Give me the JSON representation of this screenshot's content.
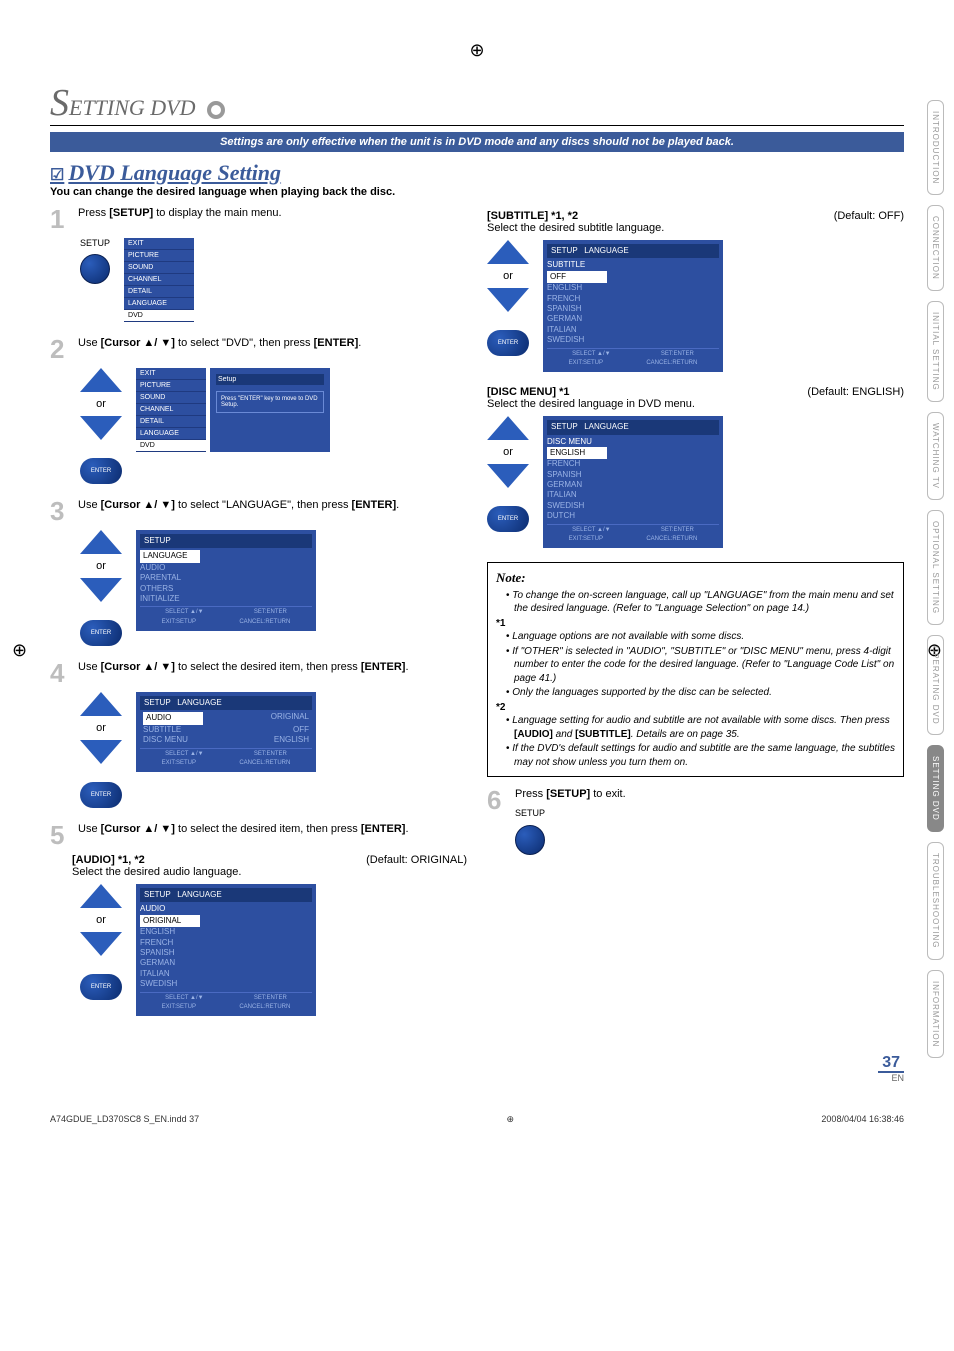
{
  "registration_mark": "⊕",
  "page_title_prefix": "S",
  "page_title_rest": "ETTING   DVD",
  "banner": "Settings are only effective when the unit is in DVD mode and any discs should not be played back.",
  "section_check": "☑",
  "section_title": "DVD Language Setting",
  "section_sub": "You can change the desired language when playing back the disc.",
  "steps": {
    "s1": {
      "num": "1",
      "text_a": "Press ",
      "b1": "[SETUP]",
      "text_b": " to display the main menu."
    },
    "s2": {
      "num": "2",
      "text_a": "Use ",
      "b1": "[Cursor ▲/ ▼]",
      "text_b": " to select \"DVD\", then press ",
      "b2": "[ENTER]",
      "text_c": "."
    },
    "s3": {
      "num": "3",
      "text_a": "Use ",
      "b1": "[Cursor ▲/ ▼]",
      "text_b": " to select \"LANGUAGE\", then press ",
      "b2": "[ENTER]",
      "text_c": "."
    },
    "s4": {
      "num": "4",
      "text_a": "Use ",
      "b1": "[Cursor ▲/ ▼]",
      "text_b": " to select the desired item, then press ",
      "b2": "[ENTER]",
      "text_c": "."
    },
    "s5": {
      "num": "5",
      "text_a": "Use ",
      "b1": "[Cursor ▲/ ▼]",
      "text_b": " to select the desired item, then press ",
      "b2": "[ENTER]",
      "text_c": "."
    },
    "s6": {
      "num": "6",
      "text_a": "Press ",
      "b1": "[SETUP]",
      "text_b": " to exit."
    }
  },
  "remote": {
    "setup": "SETUP",
    "or": "or",
    "enter": "ENTER"
  },
  "osd_main_menu": [
    "EXIT",
    "PICTURE",
    "SOUND",
    "CHANNEL",
    "DETAIL",
    "LANGUAGE",
    "DVD"
  ],
  "osd_setup_hdr": "Setup",
  "osd_setup_msg": "Press \"ENTER\" key to move to DVD Setup.",
  "osd_lang_menu": {
    "hdr": "SETUP",
    "sel": "LANGUAGE",
    "items": [
      "AUDIO",
      "PARENTAL",
      "OTHERS",
      "INITIALIZE"
    ]
  },
  "osd_item_menu": {
    "hdr": "SETUP",
    "crumb": "LANGUAGE",
    "rows": [
      [
        "AUDIO",
        "ORIGINAL"
      ],
      [
        "SUBTITLE",
        "OFF"
      ],
      [
        "DISC MENU",
        "ENGLISH"
      ]
    ]
  },
  "osd_foot": {
    "l1": "SELECT ▲/▼",
    "l2": "EXIT:SETUP",
    "r1": "SET:ENTER",
    "r2": "CANCEL:RETURN"
  },
  "audio": {
    "head": "[AUDIO] *1, *2",
    "def": "(Default: ORIGINAL)",
    "line": "Select the desired audio language.",
    "osd_hdr": "SETUP",
    "crumb": "LANGUAGE",
    "sub": "AUDIO",
    "sel": "ORIGINAL",
    "items": [
      "ENGLISH",
      "FRENCH",
      "SPANISH",
      "GERMAN",
      "ITALIAN",
      "SWEDISH"
    ]
  },
  "subtitle": {
    "head": "[SUBTITLE] *1, *2",
    "def": "(Default: OFF)",
    "line": "Select the desired subtitle language.",
    "sub": "SUBTITLE",
    "sel": "OFF",
    "items": [
      "ENGLISH",
      "FRENCH",
      "SPANISH",
      "GERMAN",
      "ITALIAN",
      "SWEDISH"
    ]
  },
  "discmenu": {
    "head": "[DISC MENU] *1",
    "def": "(Default: ENGLISH)",
    "line": "Select the desired language in DVD menu.",
    "sub": "DISC MENU",
    "sel": "ENGLISH",
    "items": [
      "FRENCH",
      "SPANISH",
      "GERMAN",
      "ITALIAN",
      "SWEDISH",
      "DUTCH"
    ]
  },
  "note": {
    "title": "Note:",
    "b1": "To change the on-screen language, call up \"LANGUAGE\" from the main menu and set the desired language. (Refer to \"Language Selection\" on page 14.)",
    "a1": "*1",
    "b2": "Language options are not available with some discs.",
    "b3": "If \"OTHER\" is selected in \"AUDIO\", \"SUBTITLE\" or \"DISC MENU\" menu, press 4-digit number to enter the code for the desired language. (Refer to \"Language Code List\" on page 41.)",
    "b4": "Only the languages supported by the disc can be selected.",
    "a2": "*2",
    "b5_a": "Language setting for audio and subtitle are not available with some discs. Then press ",
    "b5_b1": "[AUDIO]",
    "b5_mid": " and ",
    "b5_b2": "[SUBTITLE]",
    "b5_c": ". Details are on page 35.",
    "b6": "If the DVD's default settings for audio and subtitle are the same language, the subtitles may not show unless you turn them on."
  },
  "tabs": [
    "INTRODUCTION",
    "CONNECTION",
    "INITIAL SETTING",
    "WATCHING TV",
    "OPTIONAL SETTING",
    "OPERATING DVD",
    "SETTING DVD",
    "TROUBLESHOOTING",
    "INFORMATION"
  ],
  "tabs_active_index": 6,
  "page_number": "37",
  "page_lang": "EN",
  "footer_left": "A74GDUE_LD370SC8 S_EN.indd   37",
  "footer_right": "2008/04/04   16:38:46"
}
